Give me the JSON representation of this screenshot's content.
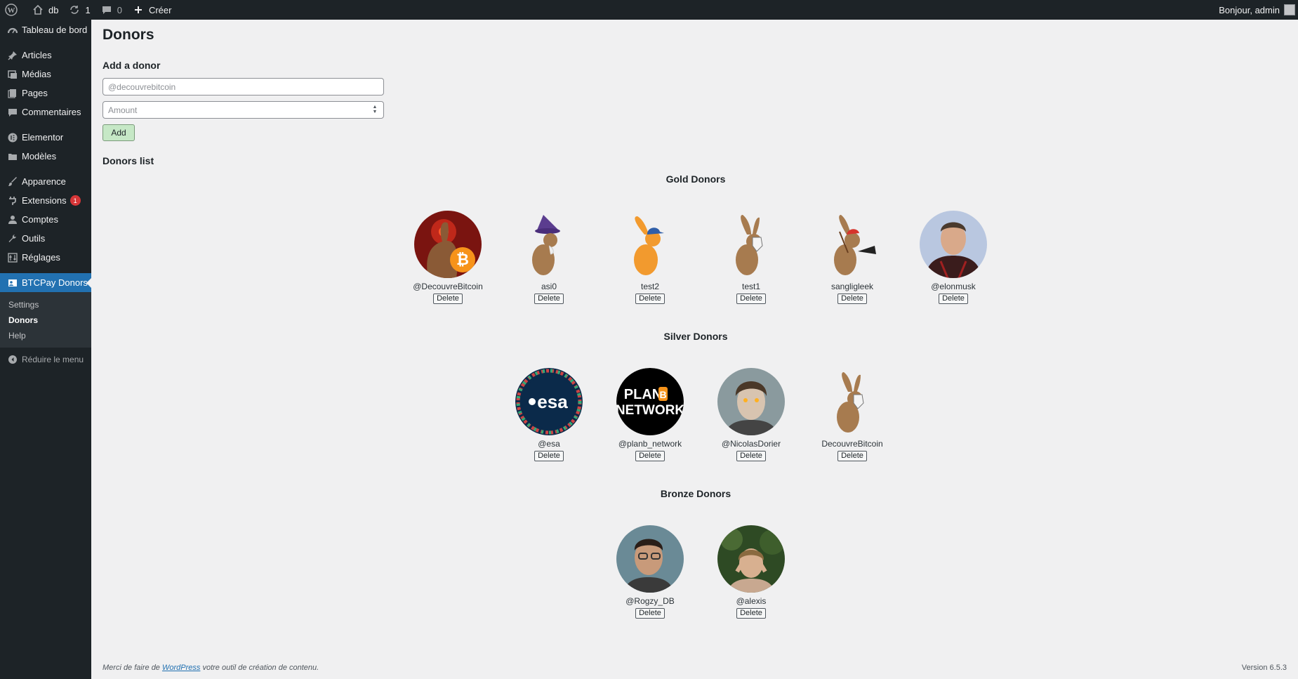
{
  "adminbar": {
    "site_name": "db",
    "updates_count": "1",
    "comments_count": "0",
    "new_label": "Créer",
    "greeting": "Bonjour, admin"
  },
  "sidebar": {
    "items": [
      {
        "label": "Tableau de bord",
        "icon": "dashboard-icon"
      },
      {
        "label": "Articles",
        "icon": "pin-icon"
      },
      {
        "label": "Médias",
        "icon": "media-icon"
      },
      {
        "label": "Pages",
        "icon": "pages-icon"
      },
      {
        "label": "Commentaires",
        "icon": "comment-icon"
      },
      {
        "label": "Elementor",
        "icon": "elementor-icon"
      },
      {
        "label": "Modèles",
        "icon": "folder-icon"
      },
      {
        "label": "Apparence",
        "icon": "brush-icon"
      },
      {
        "label": "Extensions",
        "icon": "plugin-icon",
        "badge": "1"
      },
      {
        "label": "Comptes",
        "icon": "user-icon"
      },
      {
        "label": "Outils",
        "icon": "wrench-icon"
      },
      {
        "label": "Réglages",
        "icon": "settings-icon"
      },
      {
        "label": "BTCPay Donors",
        "icon": "donor-card-icon"
      }
    ],
    "submenu": [
      "Settings",
      "Donors",
      "Help"
    ],
    "collapse_label": "Réduire le menu"
  },
  "main": {
    "title": "Donors",
    "add_heading": "Add a donor",
    "handle_placeholder": "@decouvrebitcoin",
    "amount_placeholder": "Amount",
    "add_label": "Add",
    "list_heading": "Donors list",
    "delete_label": "Delete",
    "tiers": [
      {
        "title": "Gold Donors",
        "donors": [
          "@DecouvreBitcoin",
          "asi0",
          "test2",
          "test1",
          "sangligleek",
          "@elonmusk"
        ]
      },
      {
        "title": "Silver Donors",
        "donors": [
          "@esa",
          "@planb_network",
          "@NicolasDorier",
          "DecouvreBitcoin"
        ]
      },
      {
        "title": "Bronze Donors",
        "donors": [
          "@Rogzy_DB",
          "@alexis"
        ]
      }
    ],
    "avatar_texts": {
      "esa": "esa",
      "planb_line1": "PLAN",
      "planb_b": "B",
      "planb_line2": "NETWORK"
    }
  },
  "footer": {
    "thanks_prefix": "Merci de faire de",
    "thanks_link": "WordPress",
    "thanks_suffix": "votre outil de création de contenu.",
    "version": "Version 6.5.3"
  },
  "colors": {
    "accent": "#2271b1",
    "adminbar": "#1d2327",
    "badge": "#d63638",
    "add_button": "#c6e8c6"
  }
}
